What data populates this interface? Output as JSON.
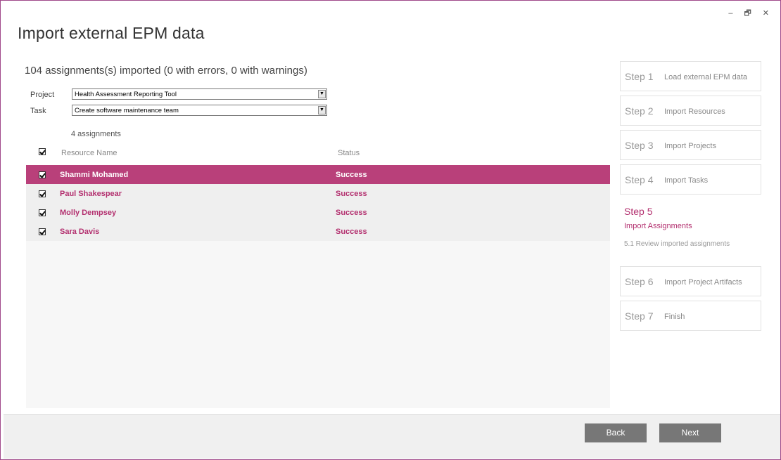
{
  "window": {
    "title": "Import external EPM data",
    "controls": {
      "minimize": "–",
      "restore": "🗗",
      "close": "✕"
    }
  },
  "summary": "104 assignments(s) imported (0 with errors, 0 with warnings)",
  "filters": {
    "project_label": "Project",
    "project_value": "Health Assessment Reporting Tool",
    "task_label": "Task",
    "task_value": "Create software maintenance team",
    "dropdown_icon": "▼"
  },
  "count_label": "4 assignments",
  "table": {
    "headers": {
      "resource": "Resource Name",
      "status": "Status"
    },
    "rows": [
      {
        "name": "Shammi Mohamed",
        "status": "Success",
        "selected": true
      },
      {
        "name": "Paul Shakespear",
        "status": "Success",
        "selected": false
      },
      {
        "name": "Molly Dempsey",
        "status": "Success",
        "selected": false
      },
      {
        "name": "Sara Davis",
        "status": "Success",
        "selected": false
      }
    ]
  },
  "steps": [
    {
      "num": "Step 1",
      "label": "Load external EPM data"
    },
    {
      "num": "Step 2",
      "label": "Import Resources"
    },
    {
      "num": "Step 3",
      "label": "Import Projects"
    },
    {
      "num": "Step 4",
      "label": "Import Tasks"
    },
    {
      "num": "Step 5",
      "label": "Import Assignments",
      "sub": "5.1 Review imported assignments",
      "current": true
    },
    {
      "num": "Step 6",
      "label": "Import Project Artifacts"
    },
    {
      "num": "Step 7",
      "label": "Finish"
    }
  ],
  "buttons": {
    "back": "Back",
    "next": "Next"
  },
  "colors": {
    "accent": "#b3306f",
    "selected_row": "#b9407a",
    "button": "#777777"
  }
}
